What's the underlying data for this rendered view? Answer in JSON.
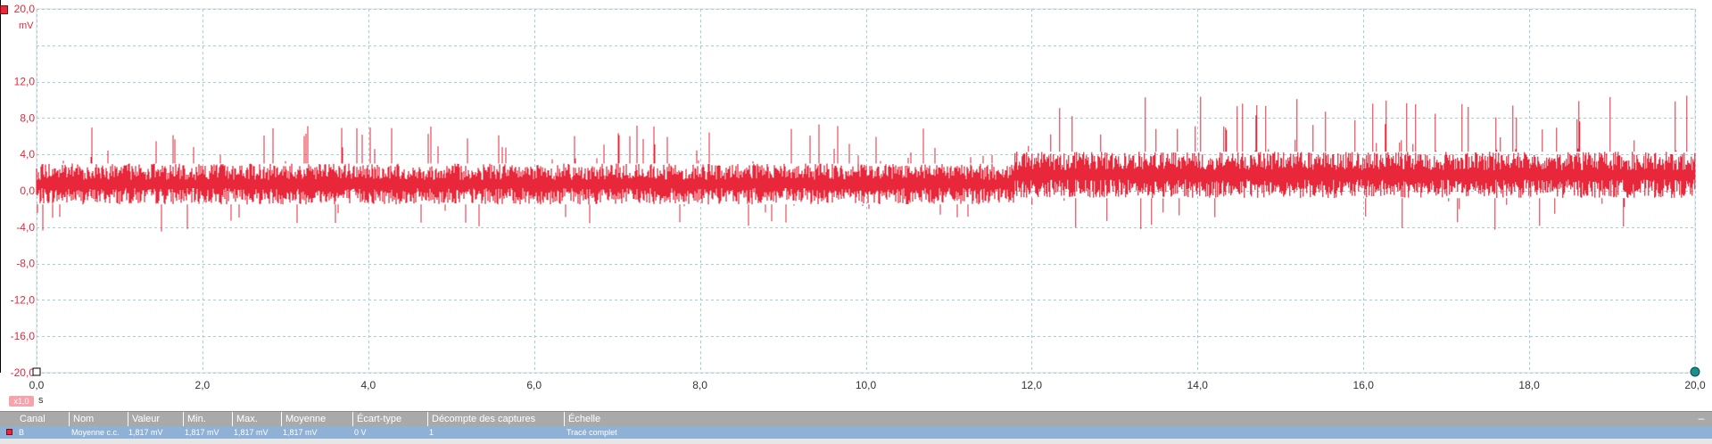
{
  "channel": {
    "color": "#e8283a",
    "name": "B"
  },
  "y_axis": {
    "unit": "mV",
    "ticks": [
      "20,0",
      "12,0",
      "8,0",
      "4,0",
      "0,0",
      "-4,0",
      "-8,0",
      "-12,0",
      "-16,0",
      "-20,0"
    ]
  },
  "x_axis": {
    "unit": "s",
    "zoom_badge": "x1,0",
    "ticks": [
      "0,0",
      "2,0",
      "4,0",
      "6,0",
      "8,0",
      "10,0",
      "12,0",
      "14,0",
      "16,0",
      "18,0",
      "20,0"
    ]
  },
  "chart_data": {
    "type": "line",
    "xlabel": "s",
    "ylabel": "mV",
    "xlim": [
      0,
      20
    ],
    "ylim": [
      -20,
      20
    ],
    "grid": true,
    "series": [
      {
        "name": "B",
        "color": "#e8283a",
        "segments": [
          {
            "x_start": 0,
            "x_end": 11.8,
            "band_low": -1.5,
            "band_high": 3.0,
            "peak_high": 7.5,
            "peak_low": -4.5,
            "mean": 0.9
          },
          {
            "x_start": 11.8,
            "x_end": 20,
            "band_low": -0.8,
            "band_high": 4.3,
            "peak_high": 10.5,
            "peak_low": -4.5,
            "mean": 1.8
          }
        ]
      }
    ]
  },
  "measurements": {
    "headers": {
      "canal": "Canal",
      "nom": "Nom",
      "valeur": "Valeur",
      "min": "Min.",
      "max": "Max.",
      "moyenne": "Moyenne",
      "ecart": "Écart-type",
      "decompte": "Décompte des captures",
      "echelle": "Échelle"
    },
    "row": {
      "canal": "B",
      "nom": "Moyenne c.c.",
      "valeur": "1,817 mV",
      "min": "1,817 mV",
      "max": "1,817 mV",
      "moyenne": "1,817 mV",
      "ecart": "0 V",
      "decompte": "1",
      "echelle": "Tracé complet"
    }
  }
}
